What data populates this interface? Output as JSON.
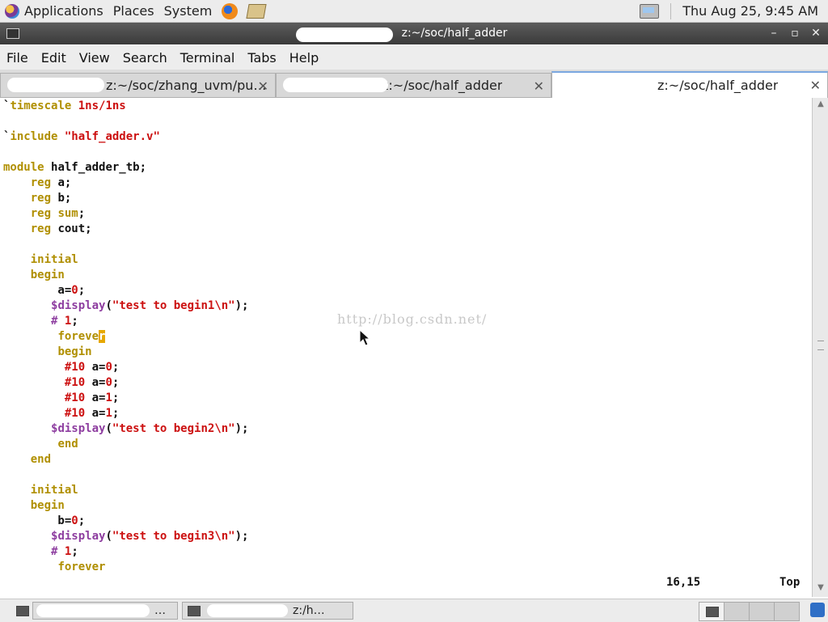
{
  "top_panel": {
    "applications": "Applications",
    "places": "Places",
    "system": "System",
    "clock": "Thu Aug 25,  9:45 AM"
  },
  "window": {
    "title": "~/soc/half_adder",
    "title_prefix": "z:"
  },
  "menu": [
    "File",
    "Edit",
    "View",
    "Search",
    "Terminal",
    "Tabs",
    "Help"
  ],
  "tabs": [
    {
      "label": "z:~/soc/zhang_uvm/pu…",
      "active": false
    },
    {
      "label": "z:~/soc/half_adder",
      "active": false
    },
    {
      "label": "z:~/soc/half_adder",
      "active": true
    }
  ],
  "code": [
    [
      [
        "pl",
        "`"
      ],
      [
        "kw",
        "timescale "
      ],
      [
        "num",
        "1ns/1ns"
      ]
    ],
    [],
    [
      [
        "pl",
        "`"
      ],
      [
        "kw",
        "include "
      ],
      [
        "str",
        "\"half_adder.v\""
      ]
    ],
    [],
    [
      [
        "kw",
        "module "
      ],
      [
        "pl",
        "half_adder_tb;"
      ]
    ],
    [
      [
        "pl",
        "    "
      ],
      [
        "kw",
        "reg "
      ],
      [
        "pl",
        "a;"
      ]
    ],
    [
      [
        "pl",
        "    "
      ],
      [
        "kw",
        "reg "
      ],
      [
        "pl",
        "b;"
      ]
    ],
    [
      [
        "pl",
        "    "
      ],
      [
        "kw",
        "reg "
      ],
      [
        "kw",
        "sum"
      ],
      [
        "pl",
        ";"
      ]
    ],
    [
      [
        "pl",
        "    "
      ],
      [
        "kw",
        "reg "
      ],
      [
        "pl",
        "cout;"
      ]
    ],
    [],
    [
      [
        "pl",
        "    "
      ],
      [
        "kw",
        "initial"
      ]
    ],
    [
      [
        "pl",
        "    "
      ],
      [
        "kw",
        "begin"
      ]
    ],
    [
      [
        "pl",
        "        a="
      ],
      [
        "num",
        "0"
      ],
      [
        "pl",
        ";"
      ]
    ],
    [
      [
        "pl",
        "       "
      ],
      [
        "sys",
        "$display"
      ],
      [
        "pl",
        "("
      ],
      [
        "str",
        "\"test to begin1\\n\""
      ],
      [
        "pl",
        ");"
      ]
    ],
    [
      [
        "pl",
        "       "
      ],
      [
        "sys",
        "# "
      ],
      [
        "num",
        "1"
      ],
      [
        "pl",
        ";"
      ]
    ],
    [
      [
        "pl",
        "        "
      ],
      [
        "kw",
        "foreve"
      ],
      [
        "cursor",
        "r"
      ]
    ],
    [
      [
        "pl",
        "        "
      ],
      [
        "kw",
        "begin"
      ]
    ],
    [
      [
        "pl",
        "         "
      ],
      [
        "num",
        "#10 "
      ],
      [
        "pl",
        "a="
      ],
      [
        "num",
        "0"
      ],
      [
        "pl",
        ";"
      ]
    ],
    [
      [
        "pl",
        "         "
      ],
      [
        "num",
        "#10 "
      ],
      [
        "pl",
        "a="
      ],
      [
        "num",
        "0"
      ],
      [
        "pl",
        ";"
      ]
    ],
    [
      [
        "pl",
        "         "
      ],
      [
        "num",
        "#10 "
      ],
      [
        "pl",
        "a="
      ],
      [
        "num",
        "1"
      ],
      [
        "pl",
        ";"
      ]
    ],
    [
      [
        "pl",
        "         "
      ],
      [
        "num",
        "#10 "
      ],
      [
        "pl",
        "a="
      ],
      [
        "num",
        "1"
      ],
      [
        "pl",
        ";"
      ]
    ],
    [
      [
        "pl",
        "       "
      ],
      [
        "sys",
        "$display"
      ],
      [
        "pl",
        "("
      ],
      [
        "str",
        "\"test to begin2\\n\""
      ],
      [
        "pl",
        ");"
      ]
    ],
    [
      [
        "pl",
        "        "
      ],
      [
        "kw",
        "end"
      ]
    ],
    [
      [
        "pl",
        "    "
      ],
      [
        "kw",
        "end"
      ]
    ],
    [],
    [
      [
        "pl",
        "    "
      ],
      [
        "kw",
        "initial"
      ]
    ],
    [
      [
        "pl",
        "    "
      ],
      [
        "kw",
        "begin"
      ]
    ],
    [
      [
        "pl",
        "        b="
      ],
      [
        "num",
        "0"
      ],
      [
        "pl",
        ";"
      ]
    ],
    [
      [
        "pl",
        "       "
      ],
      [
        "sys",
        "$display"
      ],
      [
        "pl",
        "("
      ],
      [
        "str",
        "\"test to begin3\\n\""
      ],
      [
        "pl",
        ");"
      ]
    ],
    [
      [
        "pl",
        "       "
      ],
      [
        "sys",
        "# "
      ],
      [
        "num",
        "1"
      ],
      [
        "pl",
        ";"
      ]
    ],
    [
      [
        "pl",
        "        "
      ],
      [
        "kw",
        "forever"
      ]
    ]
  ],
  "status": {
    "position": "16,15",
    "scroll": "Top"
  },
  "watermark": "http://blog.csdn.net/",
  "taskbar": {
    "task1": "…",
    "task2": "z:/h…"
  }
}
